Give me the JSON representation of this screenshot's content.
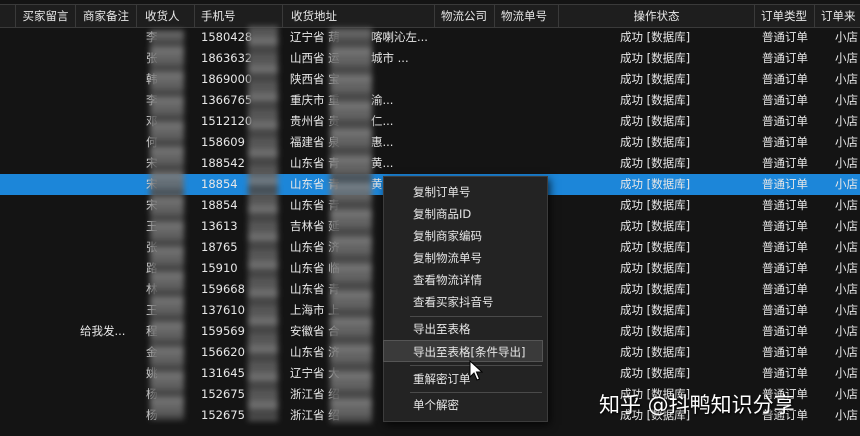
{
  "headers": [
    "买家留言",
    "商家备注",
    "收货人",
    "手机号",
    "收货地址",
    "物流公司",
    "物流单号",
    "操作状态",
    "订单类型",
    "订单来"
  ],
  "rows": [
    {
      "receiver": "李",
      "phone": "1580428",
      "addr": "辽宁省 葫",
      "addr2": "喀喇沁左...",
      "status": "成功 [数据库]",
      "type": "普通订单",
      "source": "小店",
      "note": ""
    },
    {
      "receiver": "张",
      "phone": "1863632",
      "addr": "山西省 运",
      "addr2": "城市 ...",
      "status": "成功 [数据库]",
      "type": "普通订单",
      "source": "小店",
      "note": ""
    },
    {
      "receiver": "韩",
      "phone": "1869000",
      "addr": "陕西省 宝",
      "addr2": "",
      "status": "成功 [数据库]",
      "type": "普通订单",
      "source": "小店",
      "note": ""
    },
    {
      "receiver": "李",
      "phone": "1366765",
      "addr": "重庆市 重",
      "addr2": "渝...",
      "status": "成功 [数据库]",
      "type": "普通订单",
      "source": "小店",
      "note": ""
    },
    {
      "receiver": "邓",
      "phone": "1512120",
      "addr": "贵州省 贵",
      "addr2": "仁...",
      "status": "成功 [数据库]",
      "type": "普通订单",
      "source": "小店",
      "note": ""
    },
    {
      "receiver": "何",
      "phone": "158609",
      "addr": "福建省 泉",
      "addr2": "惠...",
      "status": "成功 [数据库]",
      "type": "普通订单",
      "source": "小店",
      "note": ""
    },
    {
      "receiver": "宋",
      "phone": "188542",
      "addr": "山东省 青",
      "addr2": "黄...",
      "status": "成功 [数据库]",
      "type": "普通订单",
      "source": "小店",
      "note": ""
    },
    {
      "receiver": "宋",
      "phone": "18854",
      "addr": "山东省 青",
      "addr2": "黄",
      "status": "成功 [数据库]",
      "type": "普通订单",
      "source": "小店",
      "note": "",
      "selected": true
    },
    {
      "receiver": "宋",
      "phone": "18854",
      "addr": "山东省 青",
      "addr2": "",
      "status": "成功 [数据库]",
      "type": "普通订单",
      "source": "小店",
      "note": ""
    },
    {
      "receiver": "王",
      "phone": "13613",
      "addr": "吉林省 延",
      "addr2": "",
      "status": "成功 [数据库]",
      "type": "普通订单",
      "source": "小店",
      "note": ""
    },
    {
      "receiver": "张",
      "phone": "18765",
      "addr": "山东省 济",
      "addr2": "",
      "status": "成功 [数据库]",
      "type": "普通订单",
      "source": "小店",
      "note": ""
    },
    {
      "receiver": "路",
      "phone": "15910",
      "addr": "山东省 临",
      "addr2": "",
      "status": "成功 [数据库]",
      "type": "普通订单",
      "source": "小店",
      "note": ""
    },
    {
      "receiver": "林",
      "phone": "159668",
      "addr": "山东省 青",
      "addr2": "",
      "status": "成功 [数据库]",
      "type": "普通订单",
      "source": "小店",
      "note": ""
    },
    {
      "receiver": "王",
      "phone": "137610",
      "addr": "上海市 上",
      "addr2": "",
      "status": "成功 [数据库]",
      "type": "普通订单",
      "source": "小店",
      "note": ""
    },
    {
      "receiver": "程",
      "phone": "159569",
      "addr": "安徽省 合",
      "addr2": "",
      "status": "成功 [数据库]",
      "type": "普通订单",
      "source": "小店",
      "note": "给我发..."
    },
    {
      "receiver": "金",
      "phone": "156620",
      "addr": "山东省 济",
      "addr2": "",
      "status": "成功 [数据库]",
      "type": "普通订单",
      "source": "小店",
      "note": ""
    },
    {
      "receiver": "姚",
      "phone": "131645",
      "addr": "辽宁省 大",
      "addr2": "",
      "status": "成功 [数据库]",
      "type": "普通订单",
      "source": "小店",
      "note": ""
    },
    {
      "receiver": "杨",
      "phone": "152675",
      "addr": "浙江省 绍",
      "addr2": "",
      "status": "成功 [数据库]",
      "type": "普通订单",
      "source": "小店",
      "note": ""
    },
    {
      "receiver": "杨",
      "phone": "152675",
      "addr": "浙江省 绍",
      "addr2": "",
      "status": "成功 [数据库]",
      "type": "普通订单",
      "source": "小店",
      "note": ""
    }
  ],
  "menu": [
    "复制订单号",
    "复制商品ID",
    "复制商家编码",
    "复制物流单号",
    "查看物流详情",
    "查看买家抖音号",
    "导出至表格",
    "导出至表格[条件导出]",
    "重解密订单",
    "单个解密"
  ],
  "watermark": "知乎 @抖鸭知识分享"
}
